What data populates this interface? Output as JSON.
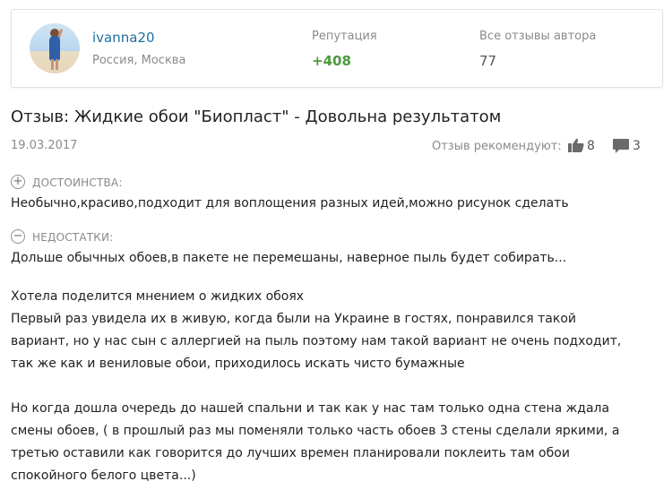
{
  "author": {
    "name": "ivanna20",
    "location": "Россия, Москва",
    "reputation_label": "Репутация",
    "reputation_value": "+408",
    "all_reviews_label": "Все отзывы автора",
    "all_reviews_value": "77"
  },
  "review": {
    "title": "Отзыв: Жидкие обои \"Биопласт\" - Довольна результатом",
    "date": "19.03.2017",
    "recommend_label": "Отзыв рекомендуют:",
    "likes": "8",
    "comments": "3",
    "pros_icon": "+",
    "pros_label": "ДОСТОИНСТВА:",
    "pros_text": "Необычно,красиво,подходит для воплощения разных идей,можно рисунок сделать",
    "cons_icon": "−",
    "cons_label": "НЕДОСТАТКИ:",
    "cons_text": "Дольше обычных обоев,в пакете не перемешаны, наверное пыль будет собирать...",
    "body_lines": [
      "Хотела поделится мнением о жидких обоях",
      "Первый раз увидела их в живую, когда были на Украине в гостях, понравился такой",
      "вариант, но у нас сын с аллергией на пыль поэтому нам такой вариант не очень подходит,",
      "так же как и вениловые обои, приходилось искать чисто бумажные",
      "Но когда дошла очередь до нашей спальни и так как у нас там только одна стена ждала",
      "смены обоев, ( в прошлый раз мы поменяли только часть обоев 3 стены сделали яркими, а",
      "третью оставили как говорится до лучших времен планировали поклеить там обои",
      "спокойного белого цвета...)"
    ]
  },
  "icons": {
    "avatar": "user-photo",
    "like": "thumbs-up-icon",
    "comment": "comment-bubble-icon",
    "plus": "plus-circle-icon",
    "minus": "minus-circle-icon"
  },
  "colors": {
    "author_name": "#1f6f9f",
    "reputation": "#4c9a3c",
    "muted": "#8a8a8a"
  }
}
